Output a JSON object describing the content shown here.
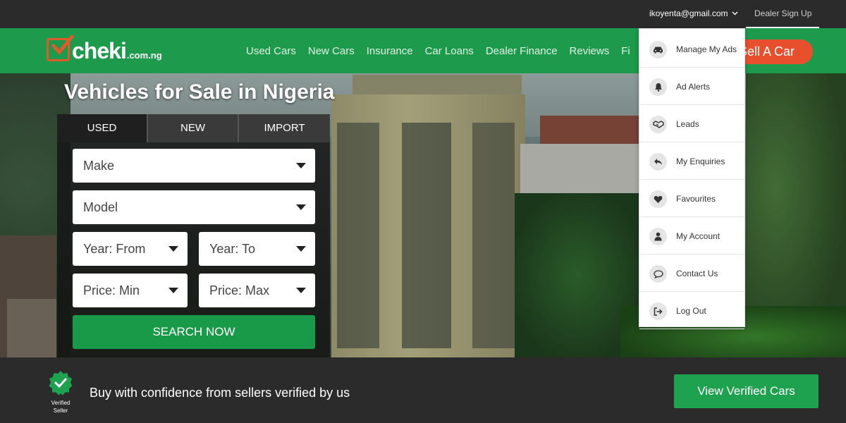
{
  "topbar": {
    "email": "ikoyenta@gmail.com",
    "dealer_signup": "Dealer Sign Up"
  },
  "logo": {
    "name": "cheki",
    "suffix": ".com.ng"
  },
  "nav": {
    "links": [
      "Used Cars",
      "New Cars",
      "Insurance",
      "Car Loans",
      "Dealer Finance",
      "Reviews",
      "Fi"
    ],
    "sell_button": "Sell A Car"
  },
  "hero": {
    "title": "Vehicles for Sale in Nigeria"
  },
  "search": {
    "tabs": [
      "USED",
      "NEW",
      "IMPORT"
    ],
    "active_tab": "USED",
    "make": "Make",
    "model": "Model",
    "year_from": "Year: From",
    "year_to": "Year: To",
    "price_min": "Price: Min",
    "price_max": "Price: Max",
    "submit": "SEARCH NOW"
  },
  "account_menu": {
    "items": [
      {
        "label": "Manage My Ads",
        "icon": "car-icon"
      },
      {
        "label": "Ad Alerts",
        "icon": "bell-icon"
      },
      {
        "label": "Leads",
        "icon": "handshake-icon"
      },
      {
        "label": "My Enquiries",
        "icon": "reply-icon"
      },
      {
        "label": "Favourites",
        "icon": "heart-icon"
      },
      {
        "label": "My Account",
        "icon": "user-icon"
      },
      {
        "label": "Contact Us",
        "icon": "chat-bubble-icon"
      },
      {
        "label": "Log Out",
        "icon": "logout-icon"
      }
    ]
  },
  "bottom": {
    "badge_line1": "Verified",
    "badge_line2": "Seller",
    "tagline": "Buy with confidence from sellers verified by us",
    "cta": "View Verified Cars"
  },
  "colors": {
    "brand_green": "#1d9a4c",
    "accent_orange": "#e8502d",
    "topbar_dark": "#2b2b2b"
  }
}
